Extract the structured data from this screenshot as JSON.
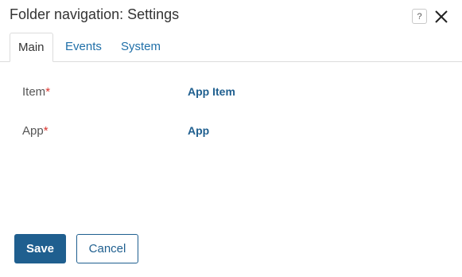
{
  "dialog": {
    "title": "Folder navigation: Settings",
    "help_glyph": "?",
    "help_icon": "help-icon",
    "close_icon": "close-icon"
  },
  "tabs": [
    {
      "label": "Main",
      "active": true
    },
    {
      "label": "Events",
      "active": false
    },
    {
      "label": "System",
      "active": false
    }
  ],
  "fields": [
    {
      "label": "Item",
      "required_mark": "*",
      "value": "App Item"
    },
    {
      "label": "App",
      "required_mark": "*",
      "value": "App"
    }
  ],
  "buttons": {
    "save_label": "Save",
    "cancel_label": "Cancel"
  },
  "colors": {
    "accent": "#1f5f8f",
    "tab_link": "#1f6fa8",
    "required": "#d9352f"
  }
}
